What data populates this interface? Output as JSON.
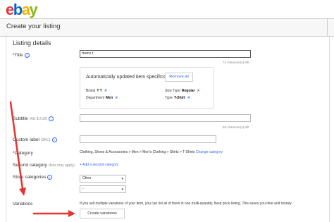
{
  "brand": {
    "letters": [
      "e",
      "b",
      "a",
      "y"
    ],
    "colors": [
      "#e53238",
      "#0064d2",
      "#f5af02",
      "#86b817"
    ]
  },
  "header": {
    "title": "Create your listing"
  },
  "section": {
    "title": "Listing details"
  },
  "title_field": {
    "label": "*Title",
    "value": "mens t",
    "counter": "74 character(s) left"
  },
  "specifics": {
    "heading": "Automatically updated item specifics",
    "remove_all": "Remove all",
    "items": [
      {
        "name": "Brand",
        "value": "T T"
      },
      {
        "name": "Size Type",
        "value": "Regular"
      },
      {
        "name": "Department",
        "value": "Men"
      },
      {
        "name": "Type",
        "value": "T-Shirt"
      }
    ]
  },
  "subtitle_field": {
    "label": "Subtitle",
    "hint": "(AU $ 2.20)",
    "counter": "55 character(s) left"
  },
  "custom_label_field": {
    "label": "Custom label",
    "hint": "(SKU)"
  },
  "category": {
    "label": "*Category",
    "path": "Clothing, Shoes & Accessories > Men > Men's Clothing > Shirts > T-Shirts",
    "change_link": "Change category"
  },
  "second_category": {
    "label": "Second category",
    "hint": "(fees may apply)",
    "add_link": "+ Add a second category"
  },
  "store_categories": {
    "label": "Store categories",
    "first": "Other",
    "second": "-"
  },
  "variations": {
    "label": "Variations",
    "text": "If you sell multiple variations of your item, you can list all of them in one multi-quantity, fixed price listing. This saves you time and money",
    "button": "Create variations"
  },
  "colors": {
    "accent": "#3665f3",
    "arrow": "#e8322e"
  }
}
